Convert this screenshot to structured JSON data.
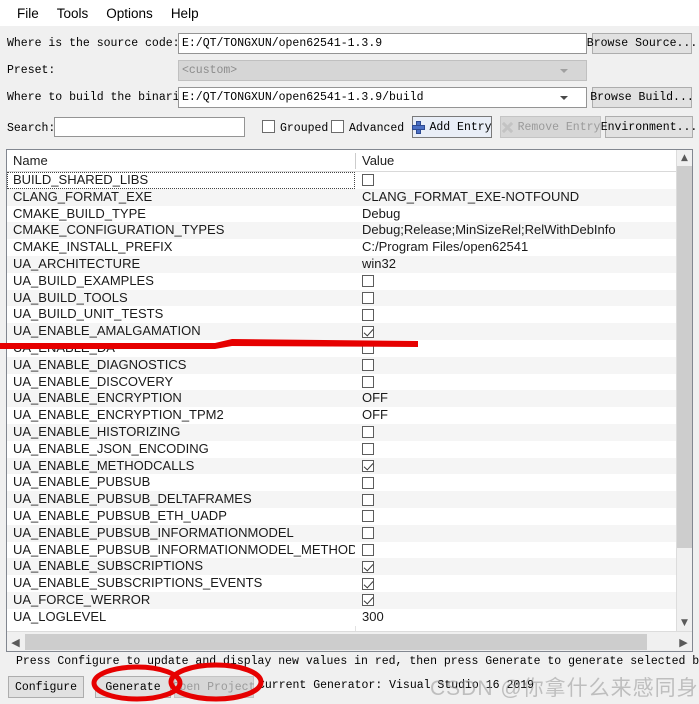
{
  "menubar": {
    "items": [
      {
        "label": "File",
        "name": "menu-file"
      },
      {
        "label": "Tools",
        "name": "menu-tools"
      },
      {
        "label": "Options",
        "name": "menu-options"
      },
      {
        "label": "Help",
        "name": "menu-help"
      }
    ]
  },
  "form": {
    "source_label": "Where is the source code:",
    "source_value": "E:/QT/TONGXUN/open62541-1.3.9",
    "browse_source_label": "Browse Source...",
    "preset_label": "Preset:",
    "preset_value": "<custom>",
    "build_label": "Where to build the binaries:",
    "build_value": "E:/QT/TONGXUN/open62541-1.3.9/build",
    "browse_build_label": "Browse Build...",
    "search_label": "Search:",
    "search_value": "",
    "grouped_label": "Grouped",
    "grouped_checked": false,
    "advanced_label": "Advanced",
    "advanced_checked": false,
    "add_entry_label": "Add Entry",
    "remove_entry_label": "Remove Entry",
    "environment_label": "Environment..."
  },
  "table": {
    "columns": [
      "Name",
      "Value"
    ],
    "rows": [
      {
        "name": "BUILD_SHARED_LIBS",
        "type": "checkbox",
        "checked": false,
        "focused": true
      },
      {
        "name": "CLANG_FORMAT_EXE",
        "type": "text",
        "value": "CLANG_FORMAT_EXE-NOTFOUND"
      },
      {
        "name": "CMAKE_BUILD_TYPE",
        "type": "text",
        "value": "Debug"
      },
      {
        "name": "CMAKE_CONFIGURATION_TYPES",
        "type": "text",
        "value": "Debug;Release;MinSizeRel;RelWithDebInfo"
      },
      {
        "name": "CMAKE_INSTALL_PREFIX",
        "type": "text",
        "value": "C:/Program Files/open62541"
      },
      {
        "name": "UA_ARCHITECTURE",
        "type": "text",
        "value": "win32"
      },
      {
        "name": "UA_BUILD_EXAMPLES",
        "type": "checkbox",
        "checked": false
      },
      {
        "name": "UA_BUILD_TOOLS",
        "type": "checkbox",
        "checked": false
      },
      {
        "name": "UA_BUILD_UNIT_TESTS",
        "type": "checkbox",
        "checked": false
      },
      {
        "name": "UA_ENABLE_AMALGAMATION",
        "type": "checkbox",
        "checked": true,
        "highlighted": true
      },
      {
        "name": "UA_ENABLE_DA",
        "type": "checkbox",
        "checked": false
      },
      {
        "name": "UA_ENABLE_DIAGNOSTICS",
        "type": "checkbox",
        "checked": false
      },
      {
        "name": "UA_ENABLE_DISCOVERY",
        "type": "checkbox",
        "checked": false
      },
      {
        "name": "UA_ENABLE_ENCRYPTION",
        "type": "text",
        "value": "OFF"
      },
      {
        "name": "UA_ENABLE_ENCRYPTION_TPM2",
        "type": "text",
        "value": "OFF"
      },
      {
        "name": "UA_ENABLE_HISTORIZING",
        "type": "checkbox",
        "checked": false
      },
      {
        "name": "UA_ENABLE_JSON_ENCODING",
        "type": "checkbox",
        "checked": false
      },
      {
        "name": "UA_ENABLE_METHODCALLS",
        "type": "checkbox",
        "checked": true
      },
      {
        "name": "UA_ENABLE_PUBSUB",
        "type": "checkbox",
        "checked": false
      },
      {
        "name": "UA_ENABLE_PUBSUB_DELTAFRAMES",
        "type": "checkbox",
        "checked": false
      },
      {
        "name": "UA_ENABLE_PUBSUB_ETH_UADP",
        "type": "checkbox",
        "checked": false
      },
      {
        "name": "UA_ENABLE_PUBSUB_INFORMATIONMODEL",
        "type": "checkbox",
        "checked": false
      },
      {
        "name": "UA_ENABLE_PUBSUB_INFORMATIONMODEL_METHODS",
        "type": "checkbox",
        "checked": false
      },
      {
        "name": "UA_ENABLE_SUBSCRIPTIONS",
        "type": "checkbox",
        "checked": true
      },
      {
        "name": "UA_ENABLE_SUBSCRIPTIONS_EVENTS",
        "type": "checkbox",
        "checked": true
      },
      {
        "name": "UA_FORCE_WERROR",
        "type": "checkbox",
        "checked": true
      },
      {
        "name": "UA_LOGLEVEL",
        "type": "text",
        "value": "300"
      }
    ]
  },
  "bottom": {
    "hint": "Press Configure to update and display new values in red, then press Generate to generate selected build files.",
    "configure_label": "Configure",
    "generate_label": "Generate",
    "open_project_label": "Open Project",
    "generator_text": "Current Generator: Visual Studio 16 2019"
  },
  "watermark": {
    "text": "CSDN @你拿什么来感同身受"
  },
  "colors": {
    "accent_red": "#e60000",
    "window_bg": "#f0f0f0",
    "row_alt": "#f5f5f5"
  }
}
